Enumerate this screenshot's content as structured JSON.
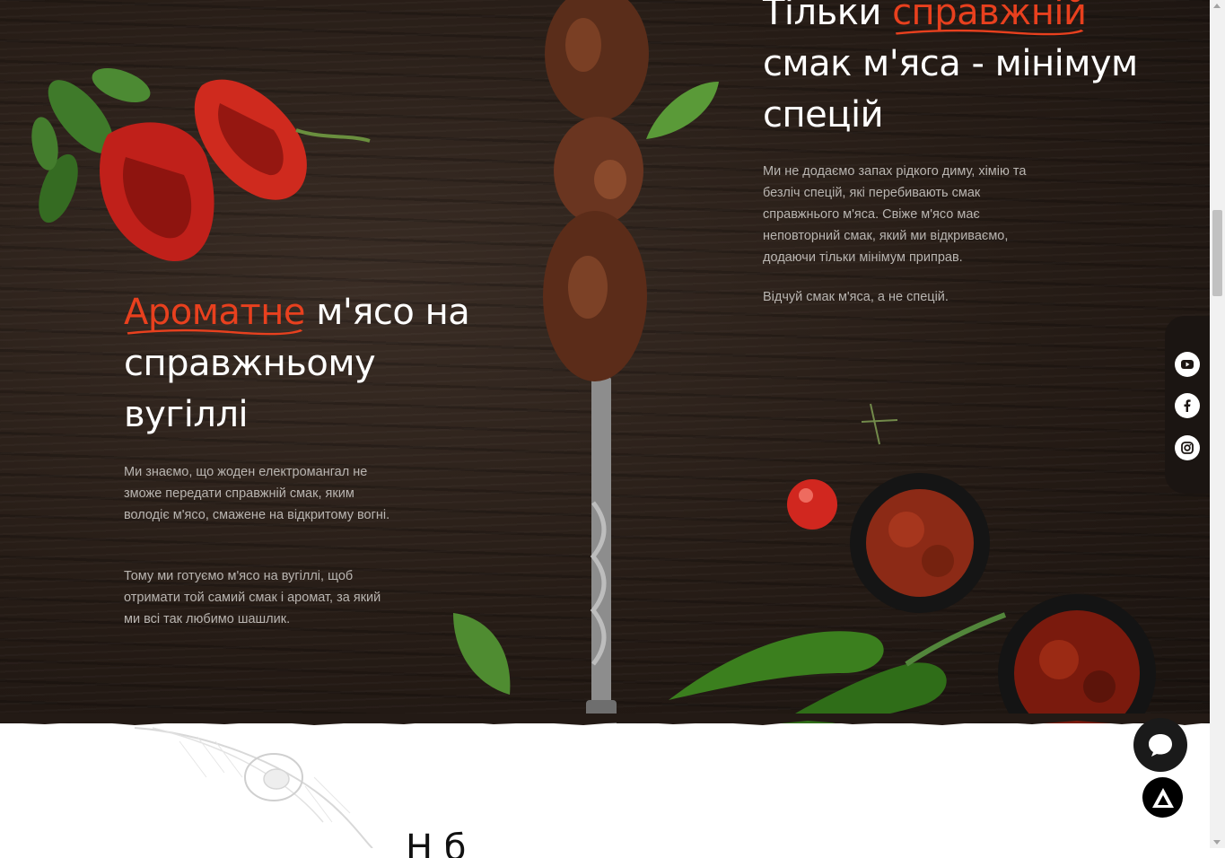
{
  "left_block": {
    "heading_accent": "Ароматне",
    "heading_rest": " м'ясо на справжньому вугіллі",
    "paragraph_1": "Ми знаємо, що жоден електромангал не зможе передати справжній смак, яким володіє м'ясо, смажене на відкритому вогні.",
    "paragraph_2": "Тому ми готуємо м'ясо на вугіллі, щоб отримати той самий смак і аромат, за який ми всі так любимо шашлик."
  },
  "right_block": {
    "heading_lead": "Тільки ",
    "heading_accent": "справжній",
    "heading_rest": " смак м'яса - мінімум спецій",
    "paragraph_1": "Ми не додаємо запах рідкого диму, хімію та безліч спецій, які перебивають смак справжнього м'яса. Свіже м'ясо має неповторний смак, який ми відкриваємо, додаючи тільки мінімум приправ.",
    "paragraph_2": "Відчуй смак м'яса, а не спецій."
  },
  "social": {
    "items": [
      {
        "icon": "youtube-icon"
      },
      {
        "icon": "facebook-icon"
      },
      {
        "icon": "instagram-icon"
      }
    ]
  },
  "next_section": {
    "heading_partial": "Н                    б"
  },
  "colors": {
    "accent": "#e8401e",
    "background_wood": "#261c16",
    "text_light": "#b9b5b1"
  }
}
